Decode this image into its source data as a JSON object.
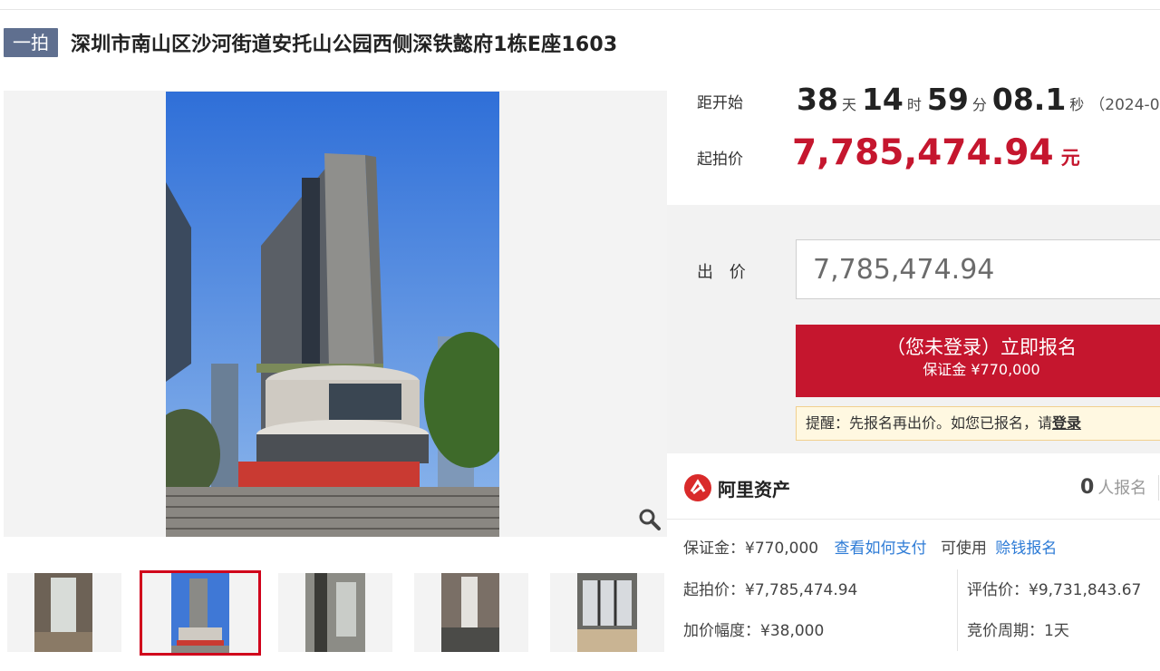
{
  "header": {
    "round_badge": "一拍",
    "title": "深圳市南山区沙河街道安托山公园西侧深铁懿府1栋E座1603"
  },
  "gallery": {
    "zoom_icon": "magnifier-icon",
    "active_thumbnail": 2,
    "thumbnail_count": 5
  },
  "auction": {
    "countdown_label": "距开始",
    "countdown": {
      "days": "38",
      "days_unit": "天",
      "hours": "14",
      "hours_unit": "时",
      "minutes": "59",
      "minutes_unit": "分",
      "seconds": "08.1",
      "seconds_unit": "秒"
    },
    "start_date_partial": "（2024-0",
    "start_price_label": "起拍价",
    "start_price": "7,785,474.94",
    "start_price_unit": "元"
  },
  "bid": {
    "label": "出 价",
    "value": "7,785,474.94",
    "signup_button": "（您未登录）立即报名",
    "signup_deposit": "保证金 ¥770,000",
    "reminder_prefix": "提醒：先报名再出价。如您已报名，请",
    "reminder_link": "登录"
  },
  "platform": {
    "name": "阿里资产",
    "logo_icon": "ali-assets-logo-icon",
    "registrations": "0",
    "registrations_text": "人报名"
  },
  "details": {
    "deposit_label": "保证金：¥770,000",
    "how_to_pay_link": "查看如何支付",
    "usable_text": "可使用",
    "earn_signup_link": "赊钱报名",
    "start_price": "起拍价：¥7,785,474.94",
    "appraisal": "评估价：¥9,731,843.67",
    "increment": "加价幅度：¥38,000",
    "period": "竞价周期：1天"
  },
  "colors": {
    "accent_red": "#c5162e",
    "badge_slate": "#5f6f8f",
    "link_blue": "#2d7bd6",
    "reminder_bg": "#fff8e1"
  }
}
